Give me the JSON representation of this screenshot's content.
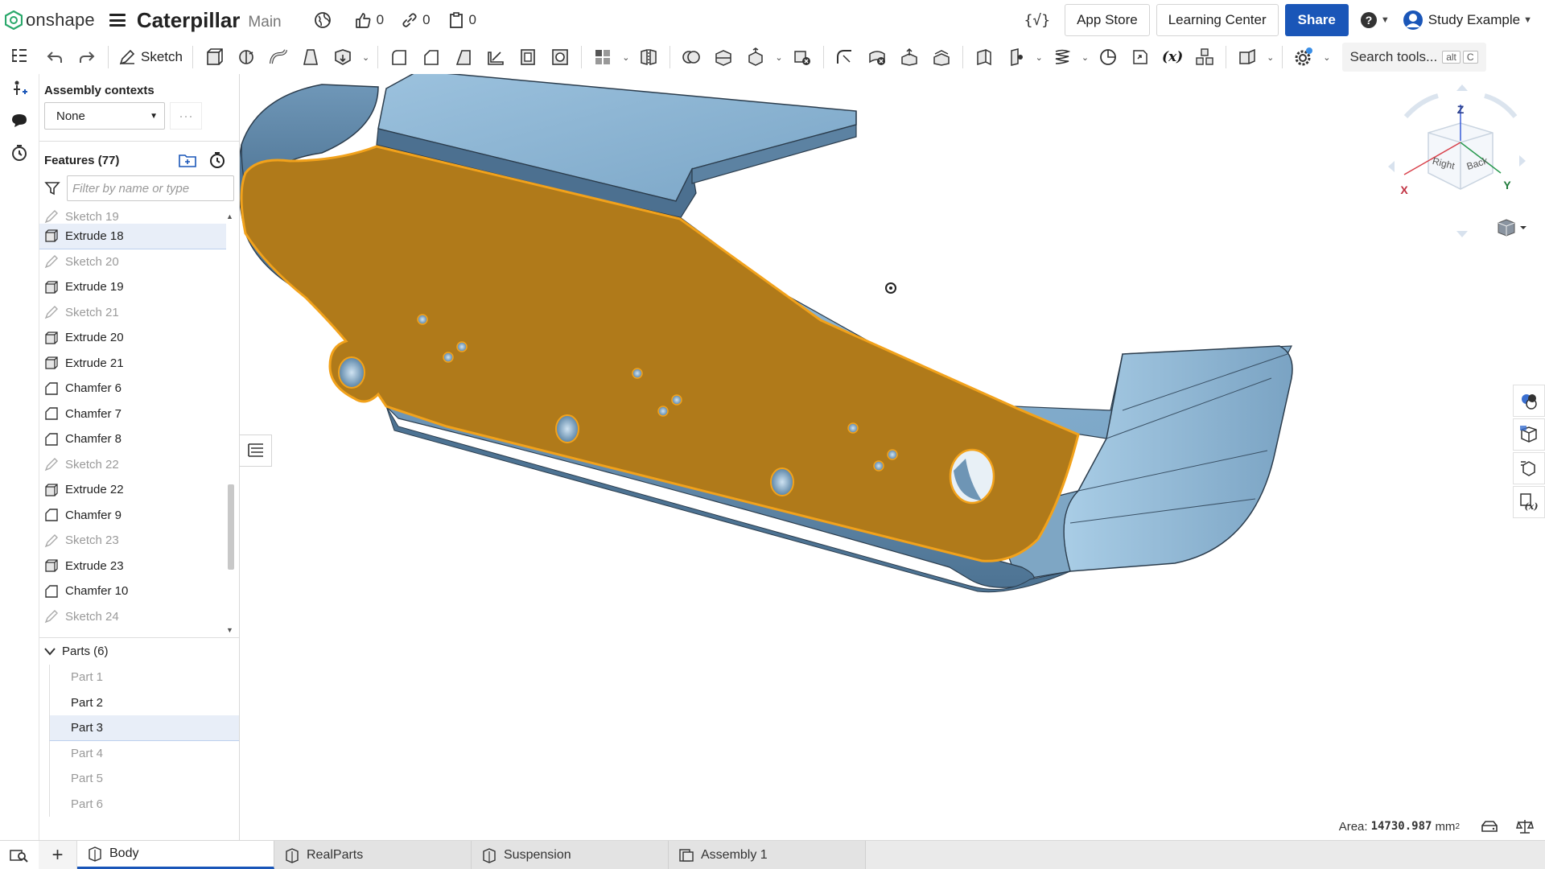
{
  "app": {
    "name": "onshape"
  },
  "document": {
    "title": "Caterpillar",
    "branch": "Main"
  },
  "stats": {
    "likes": "0",
    "links": "0",
    "copies": "0"
  },
  "header": {
    "app_store": "App Store",
    "learning_center": "Learning Center",
    "share": "Share",
    "user_name": "Study Example"
  },
  "toolbar": {
    "sketch_label": "Sketch",
    "search_label": "Search tools...",
    "search_kbd_1": "alt",
    "search_kbd_2": "C"
  },
  "panel": {
    "assembly_contexts_label": "Assembly contexts",
    "context_value": "None",
    "features_label": "Features (77)",
    "filter_placeholder": "Filter by name or type",
    "features": [
      {
        "label": "Sketch 19",
        "kind": "sketch"
      },
      {
        "label": "Extrude 18",
        "kind": "extrude",
        "selected": true
      },
      {
        "label": "Sketch 20",
        "kind": "sketch"
      },
      {
        "label": "Extrude 19",
        "kind": "extrude"
      },
      {
        "label": "Sketch 21",
        "kind": "sketch"
      },
      {
        "label": "Extrude 20",
        "kind": "extrude"
      },
      {
        "label": "Extrude 21",
        "kind": "extrude"
      },
      {
        "label": "Chamfer 6",
        "kind": "chamfer"
      },
      {
        "label": "Chamfer 7",
        "kind": "chamfer"
      },
      {
        "label": "Chamfer 8",
        "kind": "chamfer"
      },
      {
        "label": "Sketch 22",
        "kind": "sketch"
      },
      {
        "label": "Extrude 22",
        "kind": "extrude"
      },
      {
        "label": "Chamfer 9",
        "kind": "chamfer"
      },
      {
        "label": "Sketch 23",
        "kind": "sketch"
      },
      {
        "label": "Extrude 23",
        "kind": "extrude"
      },
      {
        "label": "Chamfer 10",
        "kind": "chamfer"
      },
      {
        "label": "Sketch 24",
        "kind": "sketch"
      }
    ],
    "parts_label": "Parts (6)",
    "parts": [
      {
        "label": "Part 1",
        "state": "hidden"
      },
      {
        "label": "Part 2",
        "state": "active"
      },
      {
        "label": "Part 3",
        "state": "selected"
      },
      {
        "label": "Part 4",
        "state": "hidden"
      },
      {
        "label": "Part 5",
        "state": "hidden"
      },
      {
        "label": "Part 6",
        "state": "hidden"
      }
    ]
  },
  "viewcube": {
    "top": "Z",
    "x": "X",
    "y": "Y",
    "face_right": "Right",
    "face_back": "Back"
  },
  "status": {
    "area_label": "Area:",
    "area_value": "14730.987",
    "area_unit": "mm",
    "area_exp": "2"
  },
  "tabs": [
    {
      "label": "Body",
      "active": true
    },
    {
      "label": "RealParts",
      "active": false
    },
    {
      "label": "Suspension",
      "active": false
    },
    {
      "label": "Assembly 1",
      "active": false
    }
  ],
  "colors": {
    "accent": "#1a56b8",
    "model_blue": "#8fb7d4",
    "selected_face": "#b07a1a",
    "highlight": "#f2a21b"
  }
}
